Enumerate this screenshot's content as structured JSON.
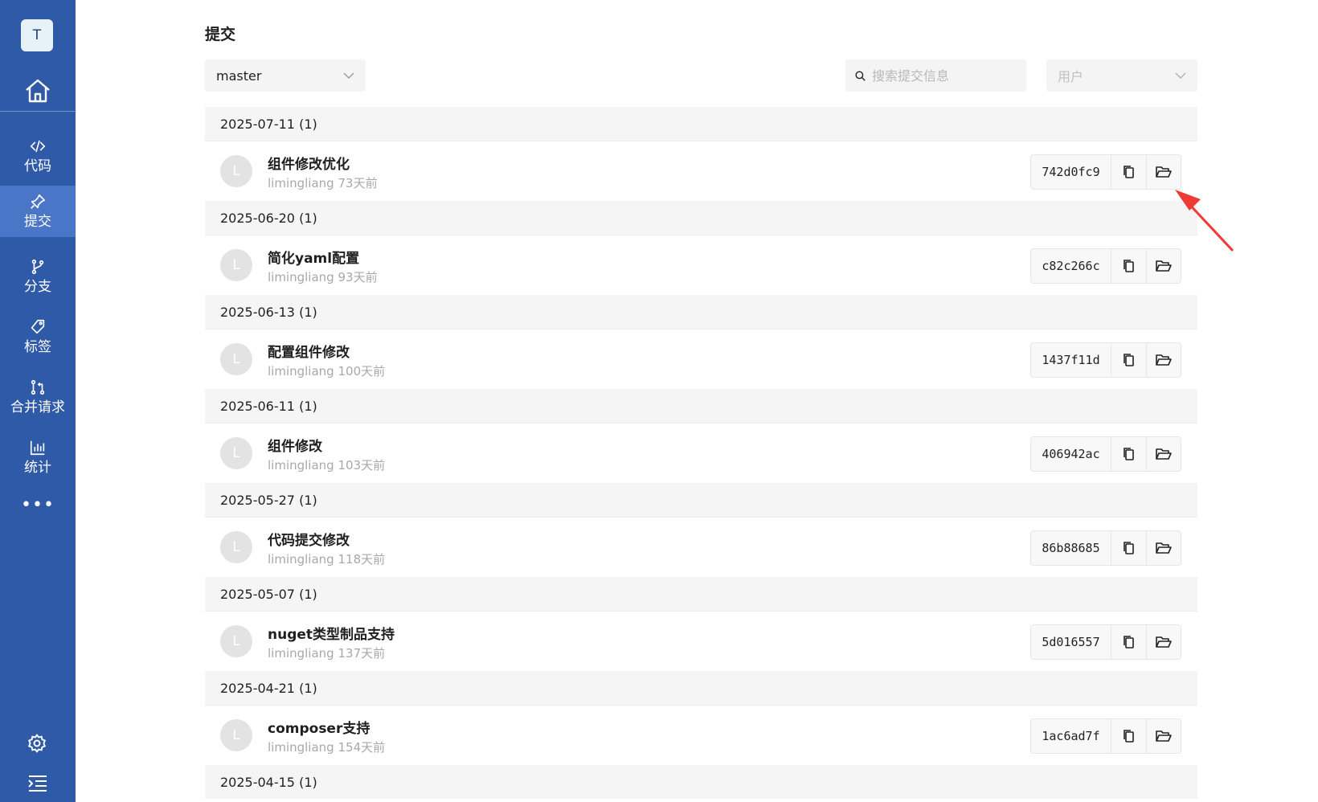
{
  "sidebar": {
    "avatar_letter": "T",
    "items": [
      {
        "label": "代码",
        "icon": "code-icon"
      },
      {
        "label": "提交",
        "icon": "pin-icon",
        "active": true
      },
      {
        "label": "分支",
        "icon": "branch-icon"
      },
      {
        "label": "标签",
        "icon": "tag-icon"
      },
      {
        "label": "合并请求",
        "icon": "merge-request-icon"
      },
      {
        "label": "统计",
        "icon": "chart-icon"
      }
    ],
    "more": "•••"
  },
  "page": {
    "title": "提交",
    "branch": "master",
    "search_placeholder": "搜索提交信息",
    "user_placeholder": "用户"
  },
  "groups": [
    {
      "date": "2025-07-11 (1)",
      "commits": [
        {
          "avatar": "L",
          "title": "组件修改优化",
          "author": "limingliang",
          "time": "73天前",
          "sha": "742d0fc9"
        }
      ]
    },
    {
      "date": "2025-06-20 (1)",
      "commits": [
        {
          "avatar": "L",
          "title": "简化yaml配置",
          "author": "limingliang",
          "time": "93天前",
          "sha": "c82c266c"
        }
      ]
    },
    {
      "date": "2025-06-13 (1)",
      "commits": [
        {
          "avatar": "L",
          "title": "配置组件修改",
          "author": "limingliang",
          "time": "100天前",
          "sha": "1437f11d"
        }
      ]
    },
    {
      "date": "2025-06-11 (1)",
      "commits": [
        {
          "avatar": "L",
          "title": "组件修改",
          "author": "limingliang",
          "time": "103天前",
          "sha": "406942ac"
        }
      ]
    },
    {
      "date": "2025-05-27 (1)",
      "commits": [
        {
          "avatar": "L",
          "title": "代码提交修改",
          "author": "limingliang",
          "time": "118天前",
          "sha": "86b88685"
        }
      ]
    },
    {
      "date": "2025-05-07 (1)",
      "commits": [
        {
          "avatar": "L",
          "title": "nuget类型制品支持",
          "author": "limingliang",
          "time": "137天前",
          "sha": "5d016557"
        }
      ]
    },
    {
      "date": "2025-04-21 (1)",
      "commits": [
        {
          "avatar": "L",
          "title": "composer支持",
          "author": "limingliang",
          "time": "154天前",
          "sha": "1ac6ad7f"
        }
      ]
    },
    {
      "date": "2025-04-15 (1)",
      "commits": []
    }
  ],
  "colors": {
    "sidebar": "#2f5aa8",
    "active": "#4a76c7",
    "annotation_arrow": "#ee3b34"
  }
}
